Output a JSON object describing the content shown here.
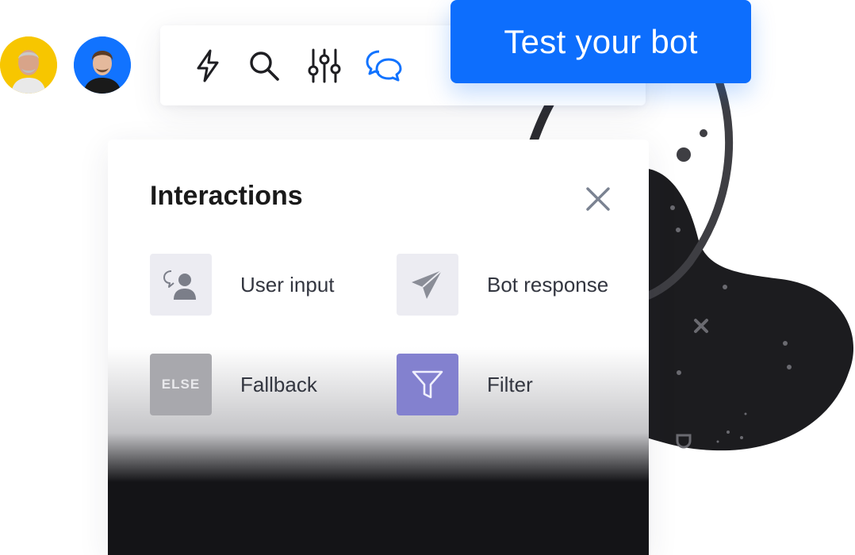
{
  "toolbar": {
    "icons": [
      "lightning-icon",
      "search-icon",
      "sliders-icon",
      "chat-bubbles-icon"
    ],
    "active_icon": "chat-bubbles-icon"
  },
  "test_button": {
    "label": "Test your bot"
  },
  "panel": {
    "title": "Interactions",
    "items": [
      {
        "label": "User input",
        "icon": "user-speech-icon"
      },
      {
        "label": "Bot response",
        "icon": "paper-plane-icon"
      },
      {
        "label": "Fallback",
        "icon": "else-icon",
        "icon_text": "ELSE"
      },
      {
        "label": "Filter",
        "icon": "funnel-icon"
      }
    ]
  },
  "colors": {
    "accent": "#0d6efd",
    "active_icon": "#1173ff",
    "tile_light": "#ececf2",
    "tile_fallback": "#a8a8ad",
    "tile_filter": "#8381cf",
    "blob": "#1c1c1f",
    "avatar_1_bg": "#f7c600",
    "avatar_2_bg": "#1173ff"
  }
}
